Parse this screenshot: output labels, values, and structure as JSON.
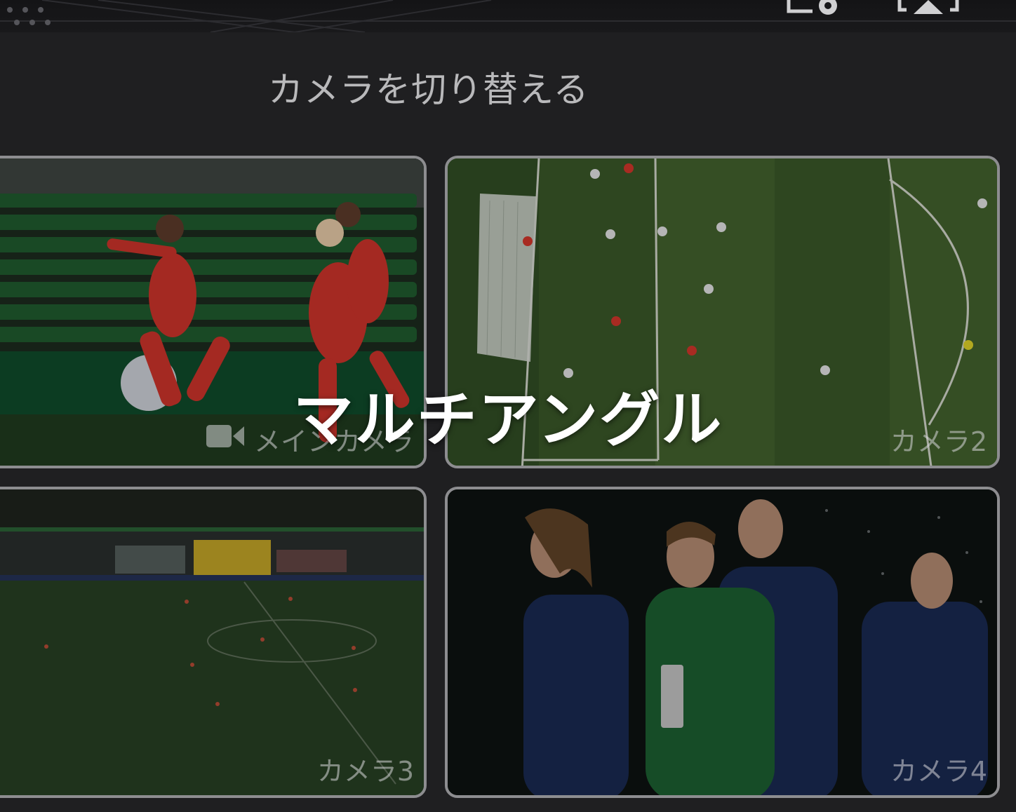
{
  "toolbar": {
    "settings_icon": "display-settings-icon",
    "airplay_icon": "airplay-icon"
  },
  "camera_switcher": {
    "title": "カメラを切り替える",
    "cameras": [
      {
        "label": "メインカメラ",
        "icon": "video-camera-icon",
        "selected": true
      },
      {
        "label": "カメラ2",
        "selected": false
      },
      {
        "label": "カメラ3",
        "selected": false
      },
      {
        "label": "カメラ4",
        "selected": false
      }
    ]
  },
  "overlay": {
    "caption": "マルチアングル"
  },
  "colors": {
    "panel_bg": "#1f1f21",
    "tile_border": "#8d8d90",
    "title_text": "#b9b9bb",
    "overlay_text": "#ffffff"
  }
}
